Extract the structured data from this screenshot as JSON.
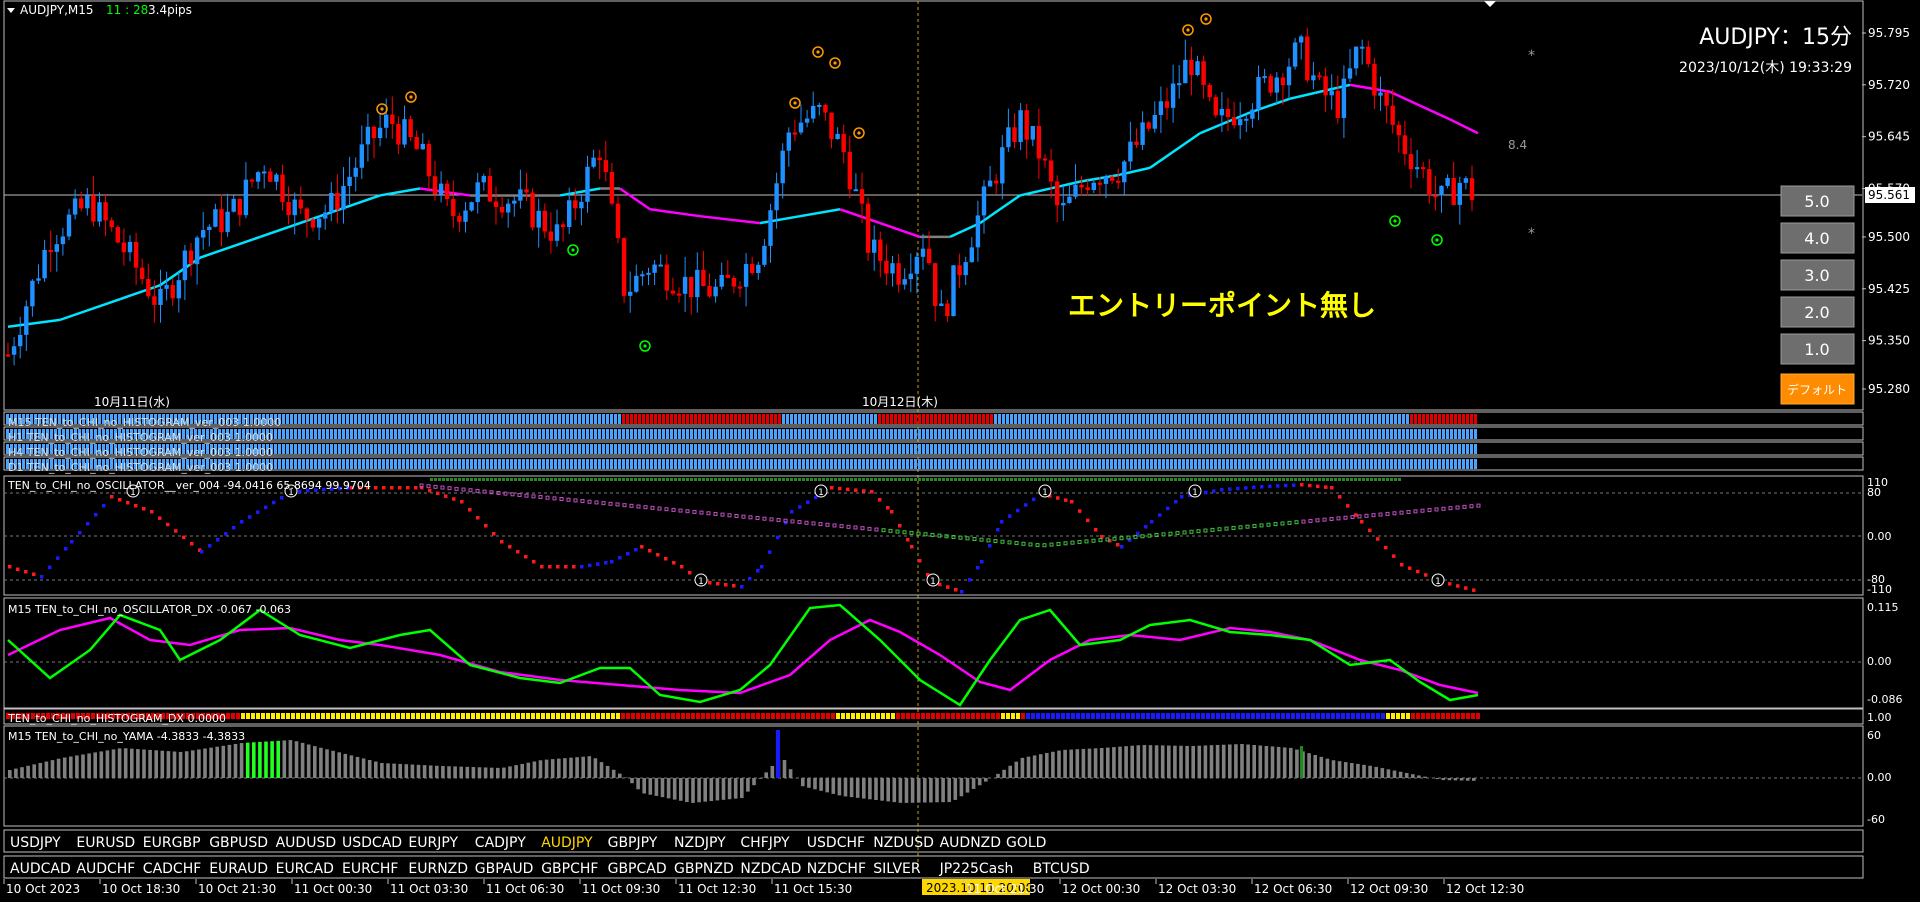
{
  "header": {
    "menu_icon": "triangle-down-icon",
    "symbol": "AUDJPY,M15",
    "countdown": "11 : 28",
    "spread": "3.4pips"
  },
  "overlay": {
    "pair_title": "AUDJPY：15分",
    "datetime": "2023/10/12(木) 19:33:29",
    "side_value": "8.4",
    "no_entry_text": "エントリーポイント無し",
    "current_price": "95.561"
  },
  "price_scale": [
    "95.795",
    "95.720",
    "95.645",
    "95.570",
    "95.500",
    "95.425",
    "95.350",
    "95.280"
  ],
  "date_labels": [
    "10月11日(水)",
    "10月12日(木)"
  ],
  "level_buttons": [
    "5.0",
    "4.0",
    "3.0",
    "2.0",
    "1.0"
  ],
  "default_button": "デフォルト",
  "histograms": [
    "M15 TEN_to_CHI_no_HISTOGRAM_ver_003 1.0000",
    "H1 TEN_to_CHI_no_HISTOGRAM_ver_003 1.0000",
    "H4 TEN_to_CHI_no_HISTOGRAM_ver_003 1.0000",
    "D1 TEN_to_CHI_no_HISTOGRAM_ver_003 1.0000"
  ],
  "oscillator": {
    "label": "TEN_to_CHI_no_OSCILLATOR__ver_004 -94.0416 65.8694 99.9704",
    "scale": [
      "110",
      "80",
      "0.00",
      "-80",
      "-110"
    ]
  },
  "dx": {
    "label": "M15 TEN_to_CHI_no_OSCILLATOR_DX -0.067 -0.063",
    "scale": [
      "0.115",
      "0.00",
      "-0.086"
    ]
  },
  "dx_hist": {
    "label": "TEN_to_CHI_no_HISTOGRAM_DX 0.0000",
    "scale": "1.00"
  },
  "yama": {
    "label": "M15 TEN_to_CHI_no_YAMA -4.3833 -4.3833",
    "scale": [
      "60",
      "0.00",
      "-60"
    ]
  },
  "symbols_row1": [
    "USDJPY",
    "EURUSD",
    "EURGBP",
    "GBPUSD",
    "AUDUSD",
    "USDCAD",
    "EURJPY",
    "CADJPY",
    "AUDJPY",
    "GBPJPY",
    "NZDJPY",
    "CHFJPY",
    "USDCHF",
    "NZDUSD",
    "AUDNZD",
    "GOLD"
  ],
  "symbols_row2": [
    "AUDCAD",
    "AUDCHF",
    "CADCHF",
    "EURAUD",
    "EURCAD",
    "EURCHF",
    "EURNZD",
    "GBPAUD",
    "GBPCHF",
    "GBPCAD",
    "GBPNZD",
    "NZDCAD",
    "NZDCHF",
    "SILVER",
    "JP225Cash",
    "BTCUSD"
  ],
  "active_symbol": "AUDJPY",
  "time_axis": [
    "10 Oct 2023",
    "10 Oct 18:30",
    "10 Oct 21:30",
    "11 Oct 00:30",
    "11 Oct 03:30",
    "11 Oct 06:30",
    "11 Oct 09:30",
    "11 Oct 12:30",
    "11 Oct 15:30",
    "2023.10.11 20:00",
    "11 Oct 21:30",
    "12 Oct 00:30",
    "12 Oct 03:30",
    "12 Oct 06:30",
    "12 Oct 09:30",
    "12 Oct 12:30"
  ],
  "colors": {
    "bull": "#1e90ff",
    "bear": "#ff0000",
    "ma_up": "#00e5ff",
    "ma_down": "#ff00ff",
    "ma_flat": "#808080",
    "osc_green": "#00ff00",
    "osc_magenta": "#ff00ff",
    "highlight": "#ffd700",
    "button": "#6e6e6e",
    "default_btn": "#ff8c00"
  }
}
